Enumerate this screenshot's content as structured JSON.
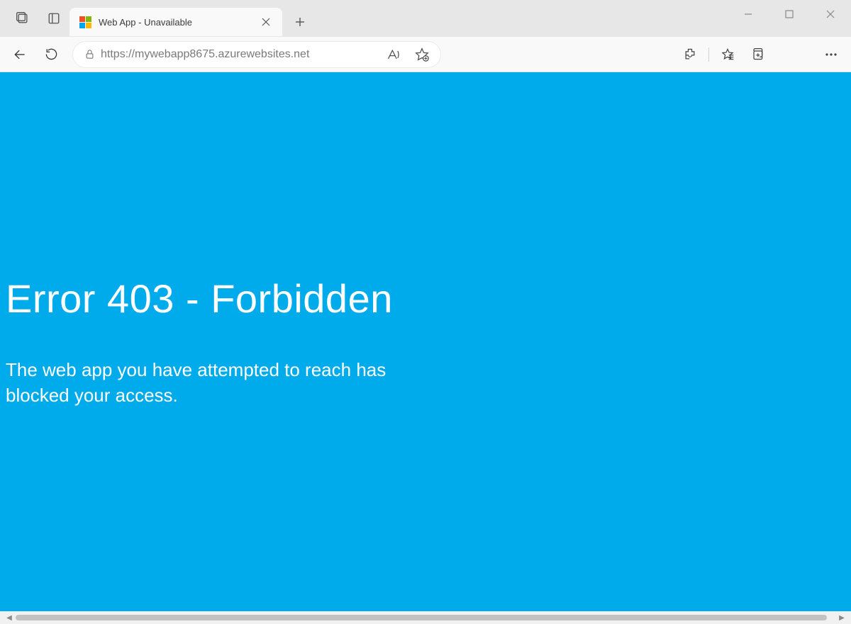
{
  "tab": {
    "title": "Web App - Unavailable"
  },
  "address": {
    "url": "https://mywebapp8675.azurewebsites.net"
  },
  "page": {
    "title": "Error 403 - Forbidden",
    "message": "The web app you have attempted to reach has blocked your access.",
    "background_color": "#00abec",
    "text_color": "#ffffff"
  }
}
